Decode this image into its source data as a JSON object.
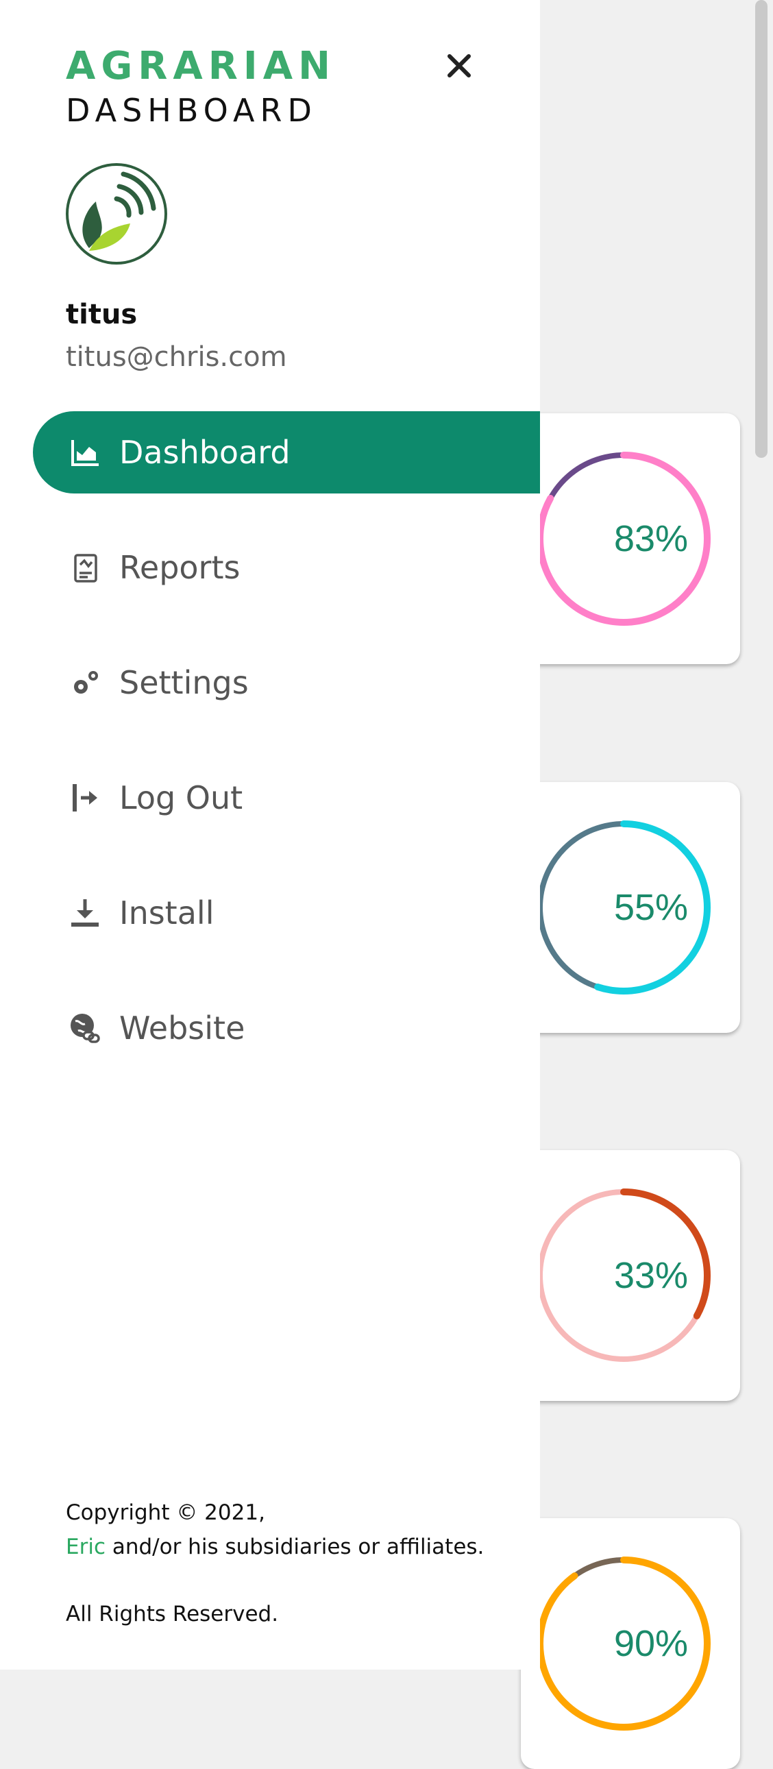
{
  "brand": {
    "line1": "AGRARIAN",
    "line2": "DASHBOARD",
    "accent_color": "#3dab6e"
  },
  "user": {
    "name": "titus",
    "email": "titus@chris.com"
  },
  "nav": {
    "active_color": "#0d8a6c",
    "items": [
      {
        "label": "Dashboard",
        "icon": "chart-line-icon",
        "active": true
      },
      {
        "label": "Reports",
        "icon": "report-icon",
        "active": false
      },
      {
        "label": "Settings",
        "icon": "gears-icon",
        "active": false
      },
      {
        "label": "Log Out",
        "icon": "logout-icon",
        "active": false
      },
      {
        "label": "Install",
        "icon": "download-icon",
        "active": false
      },
      {
        "label": "Website",
        "icon": "globe-link-icon",
        "active": false
      }
    ]
  },
  "footer": {
    "copyright": "Copyright © 2021,",
    "owner_link": "Eric",
    "owner_rest": " and/or his subsidiaries or affiliates.",
    "rights": "All Rights Reserved."
  },
  "gauges": [
    {
      "value_text": "83%",
      "percent": 83,
      "color": "#ff7fc8",
      "track": "#6a4a8a"
    },
    {
      "value_text": "55%",
      "percent": 55,
      "color": "#12d0e0",
      "track": "#557a8a"
    },
    {
      "value_text": "33%",
      "percent": 33,
      "color": "#d04a1a",
      "track": "#f7b8b8"
    },
    {
      "value_text": "90%",
      "percent": 90,
      "color": "#ffa500",
      "track": "#776655"
    }
  ]
}
